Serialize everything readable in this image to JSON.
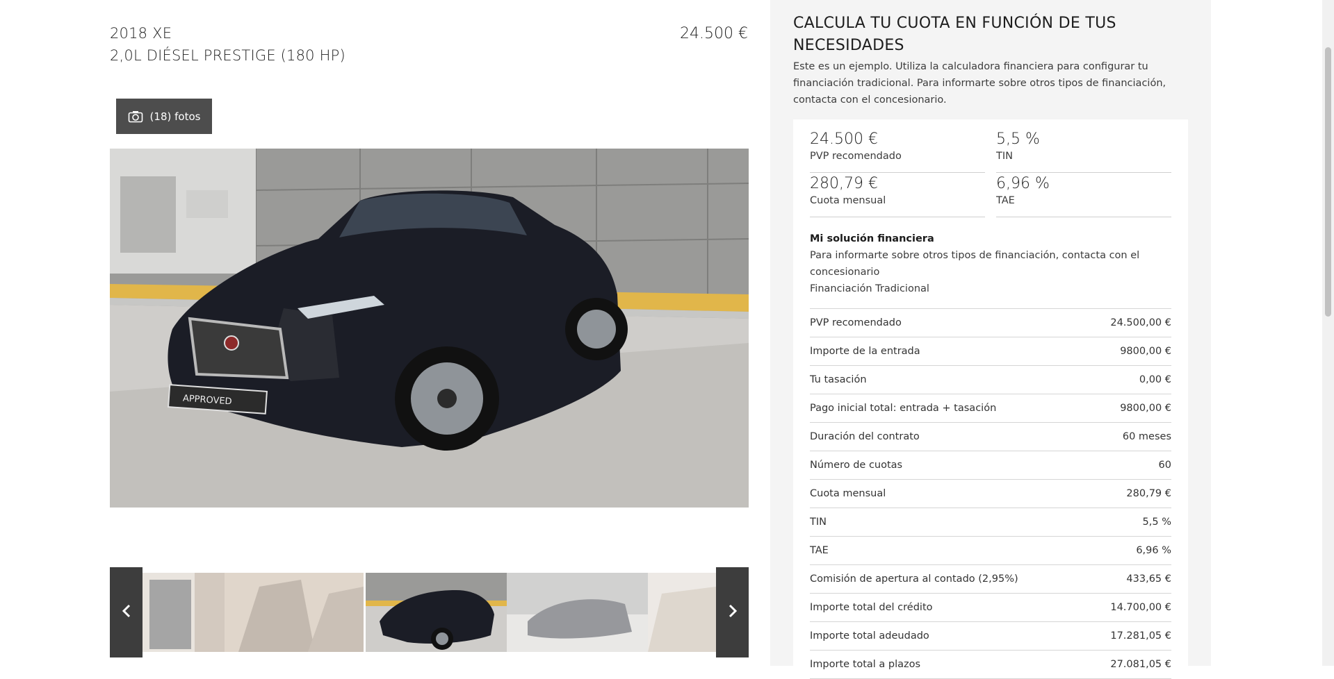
{
  "vehicle": {
    "year_model": "2018 XE",
    "trim": "2,0L DIÉSEL PRESTIGE (180 HP)",
    "price": "24.500 €"
  },
  "gallery": {
    "photos_button": "(18) fotos",
    "badge_text": "APPROVED",
    "prev_icon": "chevron-left-icon",
    "next_icon": "chevron-right-icon"
  },
  "calculator": {
    "title": "CALCULA TU CUOTA EN FUNCIÓN DE TUS NECESIDADES",
    "description": "Este es un ejemplo. Utiliza la calculadora financiera para configurar tu financiación tradicional. Para informarte sobre otros tipos de financiación, contacta con el concesionario.",
    "summary": [
      {
        "value": "24.500 €",
        "label": "PVP recomendado"
      },
      {
        "value": "5,5 %",
        "label": "TIN"
      },
      {
        "value": "280,79 €",
        "label": "Cuota mensual"
      },
      {
        "value": "6,96 %",
        "label": "TAE"
      }
    ],
    "solution_title": "Mi solución financiera",
    "solution_text": "Para informarte sobre otros tipos de financiación, contacta con el concesionario",
    "solution_type": "Financiación Tradicional",
    "rows": [
      {
        "label": "PVP recomendado",
        "value": "24.500,00 €"
      },
      {
        "label": "Importe de la entrada",
        "value": "9800,00 €"
      },
      {
        "label": "Tu tasación",
        "value": "0,00 €"
      },
      {
        "label": "Pago inicial total: entrada + tasación",
        "value": "9800,00 €"
      },
      {
        "label": "Duración del contrato",
        "value": "60 meses"
      },
      {
        "label": "Número de cuotas",
        "value": "60"
      },
      {
        "label": "Cuota mensual",
        "value": "280,79 €"
      },
      {
        "label": "TIN",
        "value": "5,5 %"
      },
      {
        "label": "TAE",
        "value": "6,96 %"
      },
      {
        "label": "Comisión de apertura al contado (2,95%)",
        "value": "433,65 €"
      },
      {
        "label": "Importe total del crédito",
        "value": "14.700,00 €"
      },
      {
        "label": "Importe total adeudado",
        "value": "17.281,05 €"
      },
      {
        "label": "Importe total a plazos",
        "value": "27.081,05 €"
      }
    ]
  }
}
